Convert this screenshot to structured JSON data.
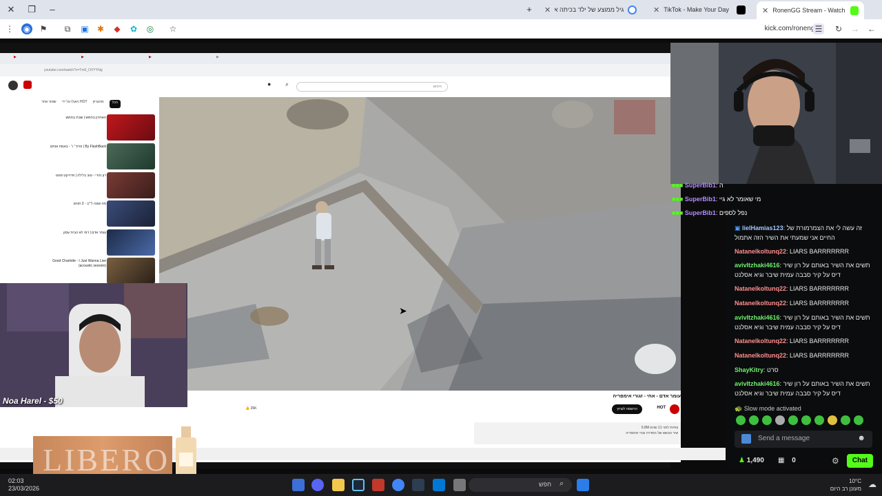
{
  "browser": {
    "tabs": [
      {
        "title": "גיל ממוצע של ילד בכיתה א - ח"
      },
      {
        "title": "TikTok - Make Your Day"
      },
      {
        "title": "RonenGG Stream - Watch Live"
      }
    ],
    "address": "kick.com/ronengg"
  },
  "inner_browser": {
    "address": "youtube.com/watch?v=Tm0_OVYYhlg",
    "search_placeholder": "חיפוש"
  },
  "video": {
    "title": "עומר אדם - אחי - זגורי אימפריה",
    "channel": "HOT",
    "subscribe_label": "הרשמה לערוץ",
    "likes": "26K",
    "views_line": "6.8M צפיות לפני 11 שנים",
    "desc_line": "שיר הנושא של הסדרה זגורי אימפריה"
  },
  "sidebar": {
    "chips": [
      "הכל",
      "מהערוץ",
      "הועלו על ידי HOT",
      "שמור אחר"
    ],
    "recommended": [
      {
        "title": "האחרון בחמש | שבת בחמש"
      },
      {
        "title": "פרוד׳ ו׳ - באמת אותם | By FlashBack"
      },
      {
        "title": "רון נהרי - טוב בלילה | פרוייקט מונגו"
      },
      {
        "title": "מה שונה ל״ב - 3 תווים"
      },
      {
        "title": "עומר אדם | דמי לא הבית עמק"
      },
      {
        "title": "Good Charlotte - I Just Wanna Live (acoustic session)"
      }
    ]
  },
  "overlay": {
    "donation": "Noa Harel - $50",
    "sponsor": "LIBERO"
  },
  "chat": {
    "overlay_messages": [
      {
        "user": "SuperBib1",
        "text": "ה"
      },
      {
        "user": "SuperBib1",
        "text": "מי שאומר לא גיי"
      },
      {
        "user": "SuperBib1",
        "text": "נפל לספים"
      }
    ],
    "messages": [
      {
        "user": "lielHamias123",
        "text": "זה עשה לי את הצמרמורת של החיים אני שמעתי את השיר הזה אתמול",
        "color": "#9fc7ff"
      },
      {
        "user": "Natanelkoltunq22",
        "text": "LIARS BARRRRRRR",
        "color": "#ff8e8e"
      },
      {
        "user": "avivItzhaki4616",
        "text": "תשים את השיר באותם על רון שיר דיס על קיר סבבה עמית שיבר וגיא אסלנט",
        "color": "#6ef06e"
      },
      {
        "user": "Natanelkoltunq22",
        "text": "LIARS BARRRRRRR",
        "color": "#ff8e8e"
      },
      {
        "user": "Natanelkoltunq22",
        "text": "LIARS BARRRRRRR",
        "color": "#ff8e8e"
      },
      {
        "user": "avivItzhaki4616",
        "text": "תשים את השיר באותם על רון שיר דיס על קיר סבבה עמית שיבר וגיא אסלנט",
        "color": "#6ef06e"
      },
      {
        "user": "Natanelkoltunq22",
        "text": "LIARS BARRRRRRR",
        "color": "#ff8e8e"
      },
      {
        "user": "Natanelkoltunq22",
        "text": "LIARS BARRRRRRR",
        "color": "#ff8e8e"
      },
      {
        "user": "ShayKitry",
        "text": "סרט",
        "color": "#6ef06e"
      },
      {
        "user": "avivItzhaki4616",
        "text": "תשים את השיר באותם על רון שיר דיס על קיר סבבה עמית שיבר וגיא אסלנט",
        "color": "#6ef06e"
      }
    ],
    "slow_mode": "Slow mode activated",
    "send_placeholder": "Send a message",
    "viewer_count": "1,490",
    "gift_count": "0",
    "chat_button": "Chat",
    "accent": "#53fc18"
  },
  "taskbar": {
    "time": "02:03",
    "date": "23/03/2026",
    "search": "חפש",
    "temp": "10°C",
    "weather": "מעונן רב היום"
  }
}
